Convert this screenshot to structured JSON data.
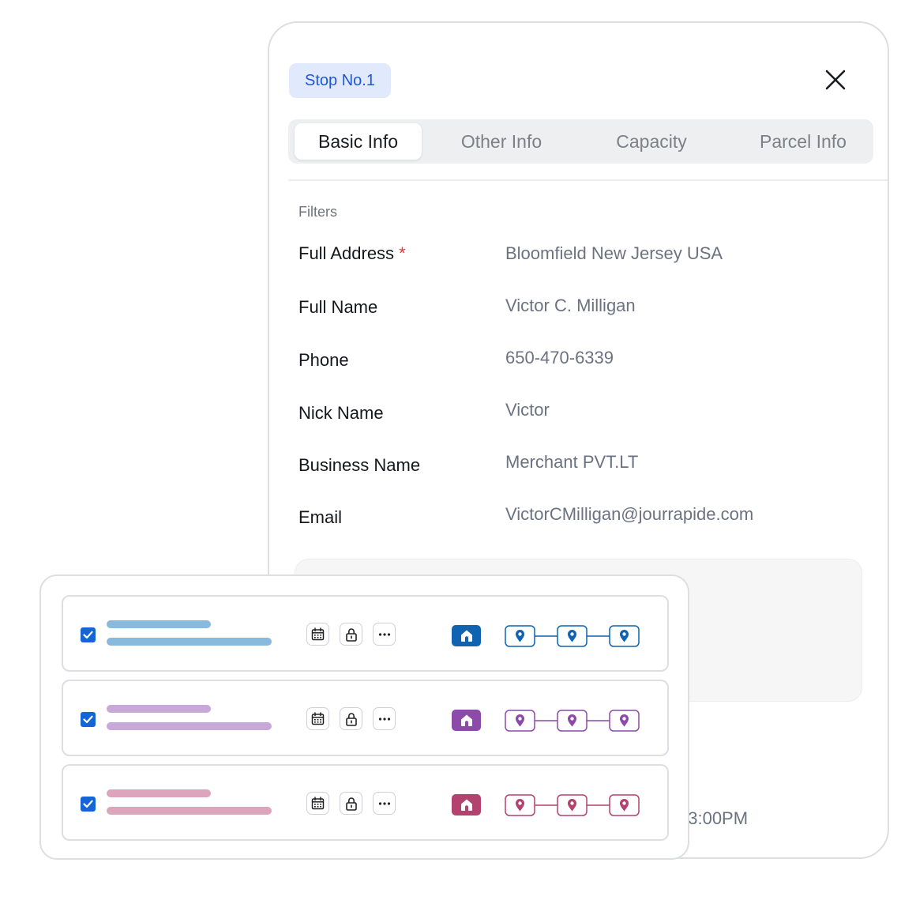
{
  "panel": {
    "stop_badge": "Stop No.1",
    "tabs": [
      {
        "label": "Basic Info",
        "active": true
      },
      {
        "label": "Other Info",
        "active": false
      },
      {
        "label": "Capacity",
        "active": false
      },
      {
        "label": "Parcel Info",
        "active": false
      }
    ],
    "section_label": "Filters",
    "required_mark": "*",
    "fields": [
      {
        "label": "Full Address",
        "value": "Bloomfield New Jersey USA",
        "required": true
      },
      {
        "label": "Full Name",
        "value": "Victor C. Milligan"
      },
      {
        "label": "Phone",
        "value": "650-470-6339"
      },
      {
        "label": "Nick Name",
        "value": "Victor"
      },
      {
        "label": "Business Name",
        "value": "Merchant PVT.LT"
      },
      {
        "label": "Email",
        "value": "VictorCMilligan@jourrapide.com"
      }
    ],
    "partial_time": "03:00PM"
  },
  "route_rows": [
    {
      "color": "#0f63b0",
      "bar_color": "#8ab9de",
      "checked": true
    },
    {
      "color": "#8c4ba8",
      "bar_color": "#c7a8d8",
      "checked": true
    },
    {
      "color": "#b2436e",
      "bar_color": "#dda5bb",
      "checked": true
    }
  ],
  "icons": {
    "close": "close-icon",
    "check": "checkbox-checked-icon",
    "calendar": "calendar-icon",
    "lock": "lock-icon",
    "more": "more-icon",
    "home": "home-icon",
    "pin": "map-pin-icon"
  },
  "colors": {
    "accent": "#1e56d6",
    "badge_bg": "#e1eafd",
    "required": "#e53935"
  }
}
